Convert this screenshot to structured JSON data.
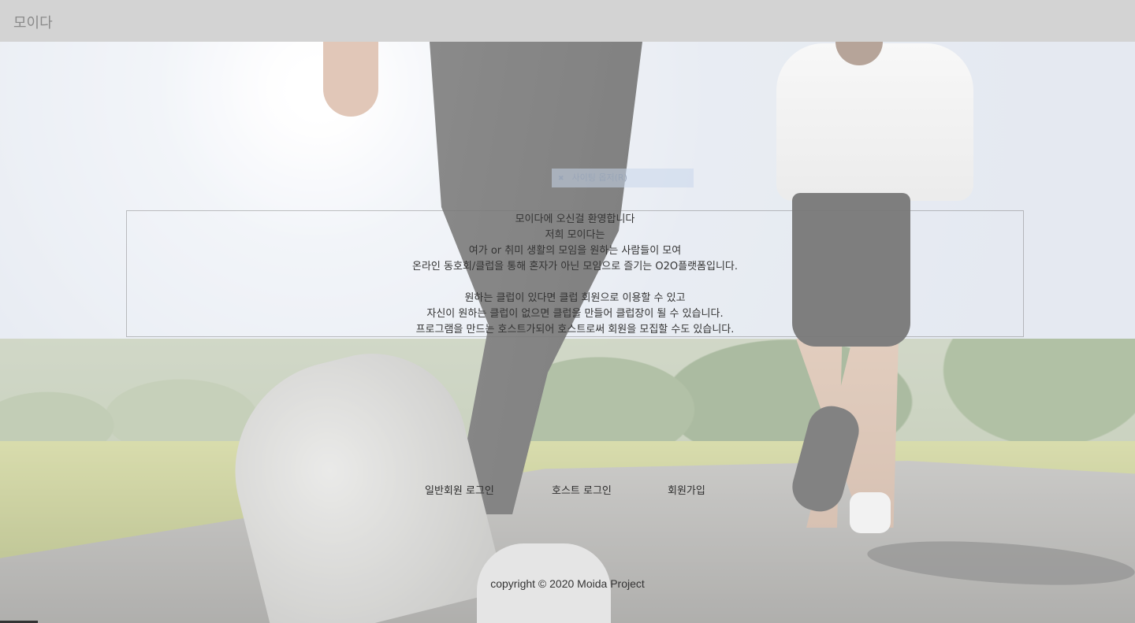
{
  "header": {
    "brand": "모이다"
  },
  "faded_badge": {
    "text": "사이팅 옵저(R)"
  },
  "welcome": {
    "lines": [
      "모이다에 오신걸 환영합니다",
      "저희 모이다는",
      "여가 or 취미 생활의 모임을 원하는 사람들이 모여",
      "온라인 동호회/클럽을 통해 혼자가 아닌 모임으로 즐기는 O2O플랫폼입니다.",
      "",
      "원하는 클럽이 있다면 클럽 회원으로 이용할 수 있고",
      "자신이 원하는 클럽이 없으면 클럽을 만들어 클럽장이 될 수 있습니다.",
      "프로그램을 만드는 호스트가되어 호스트로써 회원을 모집할 수도 있습니다."
    ]
  },
  "nav": {
    "member_login": "일반회원 로그인",
    "host_login": "호스트 로그인",
    "signup": "회원가입"
  },
  "footer": {
    "copyright": "copyright © 2020 Moida Project"
  },
  "colors": {
    "topbar_bg": "#d3d3d3",
    "brand_text": "#8a8a8a",
    "body_text": "#333333"
  }
}
